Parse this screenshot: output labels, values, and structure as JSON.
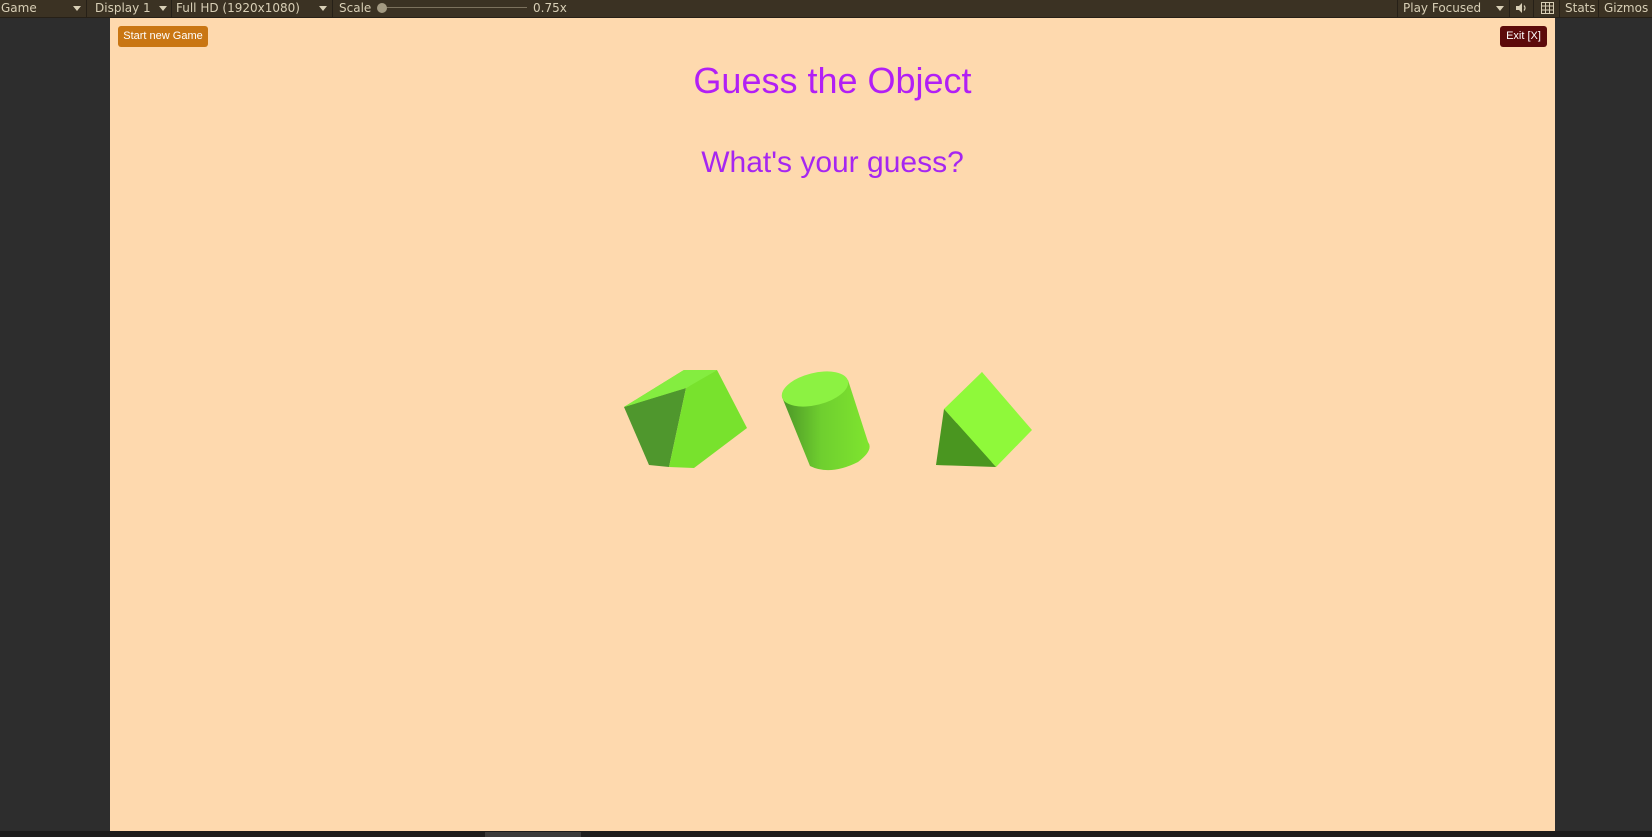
{
  "toolbar": {
    "view_label": "Game",
    "display_label": "Display 1",
    "resolution_label": "Full HD (1920x1080)",
    "scale_label": "Scale",
    "scale_value": "0.75x",
    "scale_fraction": 0.0,
    "play_mode_label": "Play Focused",
    "stats_label": "Stats",
    "gizmos_label": "Gizmos"
  },
  "game": {
    "start_button_label": "Start new Game",
    "exit_button_label": "Exit [X]",
    "title": "Guess the Object",
    "prompt": "What's your guess?",
    "objects": [
      "cube-icon",
      "cylinder-icon",
      "pyramid-icon"
    ],
    "colors": {
      "background": "#fed9ae",
      "title": "#b21ff5",
      "start_button": "#c97613",
      "exit_button": "#5c0a0a",
      "object_green": "#7ee52f"
    }
  }
}
